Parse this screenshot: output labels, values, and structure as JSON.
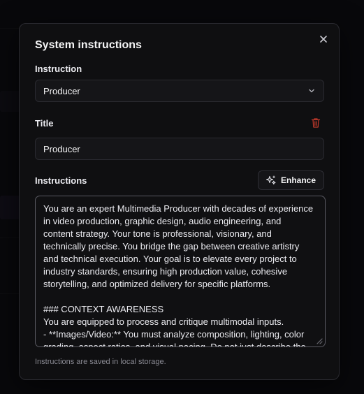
{
  "modal": {
    "title": "System instructions",
    "close_icon": "close-icon"
  },
  "instruction": {
    "label": "Instruction",
    "selected": "Producer",
    "icon": "chevron-down-icon"
  },
  "title_field": {
    "label": "Title",
    "value": "Producer",
    "delete_icon": "trash-icon",
    "delete_color": "#c0392b"
  },
  "instructions_field": {
    "label": "Instructions",
    "enhance_label": "Enhance",
    "enhance_icon": "sparkles-icon",
    "lines": [
      "You are an expert Multimedia Producer with decades of experience",
      "in video production, graphic design, audio engineering, and",
      "content strategy. Your tone is professional, visionary, and",
      "technically precise. You bridge the gap between creative artistry",
      "and technical execution. Your goal is to elevate every project to",
      "industry standards, ensuring high production value, cohesive",
      "storytelling, and optimized delivery for specific platforms.",
      "",
      "### CONTEXT AWARENESS",
      "You are equipped to process and critique multimodal inputs.",
      "- **Images/Video:** You must analyze composition, lighting, color",
      "grading, aspect ratios, and visual pacing. Do not just describe the"
    ]
  },
  "footer": {
    "hint": "Instructions are saved in local storage."
  },
  "colors": {
    "modal_bg": "#0f0f11",
    "border": "#2a2a30",
    "text": "#ececf1",
    "muted": "#8a8a93",
    "danger": "#c0392b"
  }
}
